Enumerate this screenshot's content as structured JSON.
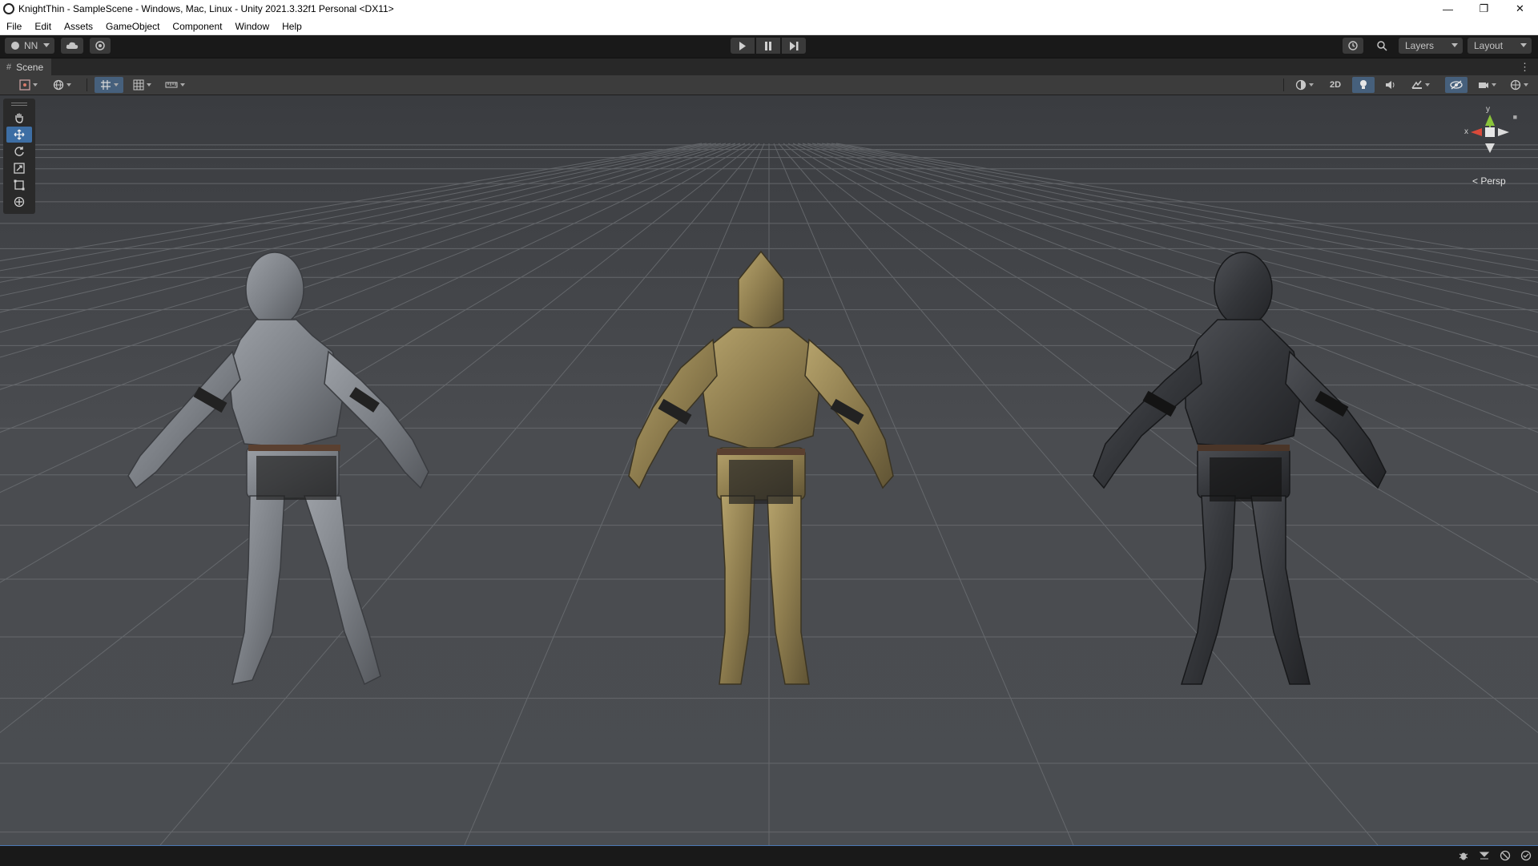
{
  "window": {
    "title": "KnightThin - SampleScene - Windows, Mac, Linux - Unity 2021.3.32f1 Personal <DX11>",
    "minimize": "—",
    "restore": "❐",
    "close": "✕"
  },
  "menu": [
    "File",
    "Edit",
    "Assets",
    "GameObject",
    "Component",
    "Window",
    "Help"
  ],
  "toolbar": {
    "account_label": "NN",
    "layers_label": "Layers",
    "layout_label": "Layout"
  },
  "scene_tab": {
    "label": "Scene",
    "menu_glyph": "⋮"
  },
  "scene_toolbar": {
    "mode_2d_label": "2D"
  },
  "gizmo": {
    "y_label": "y",
    "x_label": "x",
    "projection_label": "Persp",
    "projection_glyph": "<"
  },
  "colors": {
    "accent": "#4c79b5",
    "active_tool": "#3d6ea4",
    "axis_x": "#d94a3a",
    "axis_y": "#8ac43a",
    "knight_silver": "#7c8086",
    "knight_gold": "#8d7c4e",
    "knight_black": "#34363a"
  },
  "knights": [
    {
      "name": "silver-knight",
      "material": "steel"
    },
    {
      "name": "gold-knight",
      "material": "brass"
    },
    {
      "name": "black-knight",
      "material": "dark iron"
    }
  ],
  "icons": {
    "tools": [
      "hand-icon",
      "move-icon",
      "rotate-icon",
      "scale-icon",
      "rect-icon",
      "transform-icon"
    ],
    "status": [
      "bug-icon",
      "progress-icon",
      "network-icon",
      "check-icon"
    ]
  }
}
